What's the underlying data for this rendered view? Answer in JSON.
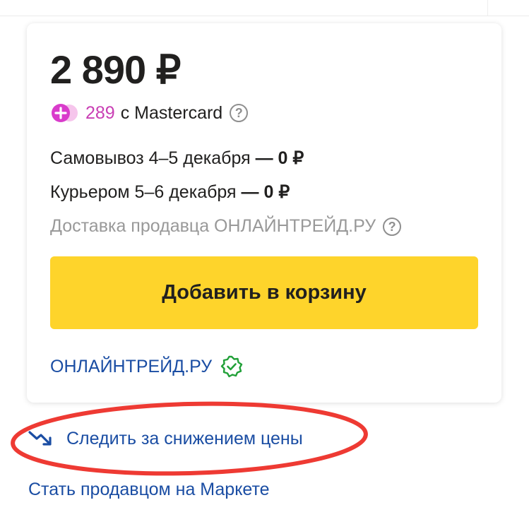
{
  "product_card": {
    "price": "2 890 ₽",
    "cashback": {
      "amount": "289",
      "text": "с Mastercard",
      "help_glyph": "?"
    },
    "delivery": {
      "pickup": "Самовывоз 4–5 декабря",
      "pickup_price": "— 0 ₽",
      "courier": "Курьером 5–6 декабря",
      "courier_price": "— 0 ₽",
      "seller_delivery": "Доставка продавца ОНЛАЙНТРЕЙД.РУ",
      "help_glyph": "?"
    },
    "add_to_cart_label": "Добавить в корзину",
    "seller_name": "ОНЛАЙНТРЕЙД.РУ"
  },
  "links": {
    "follow_price_drop": "Следить за снижением цены",
    "become_seller": "Стать продавцом на Маркете"
  },
  "icons": {
    "plus": "yandex-plus-icon",
    "help": "question-circle-icon",
    "verified": "verified-badge-icon",
    "trend_down": "trend-down-icon"
  },
  "colors": {
    "button_yellow": "#fed42b",
    "link_blue": "#1a4da3",
    "cashback_pink": "#c93fb4",
    "annotation_red": "#ee3a33",
    "verified_green": "#21a038"
  }
}
